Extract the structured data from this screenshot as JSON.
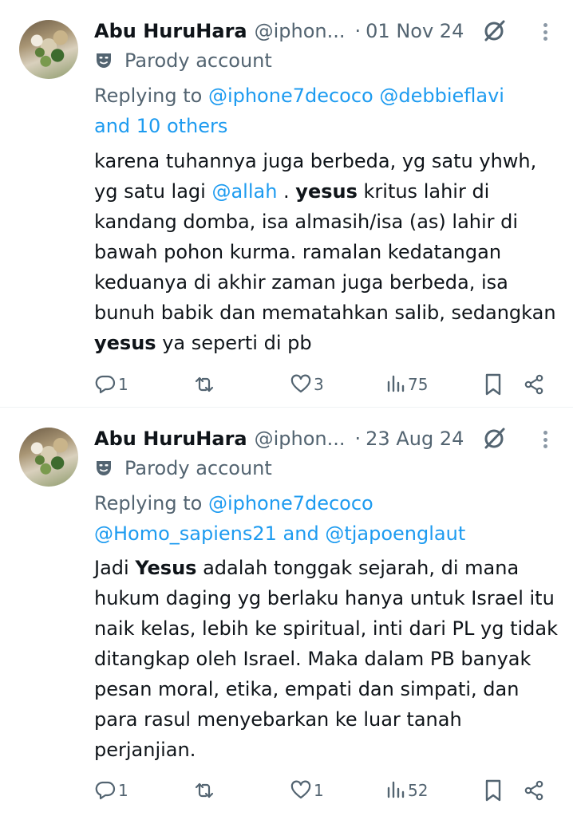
{
  "tweets": [
    {
      "name": "Abu HuruHara",
      "handle": "@iphon...",
      "date": "01 Nov 24",
      "badge": "Parody account",
      "replying_prefix": "Replying to ",
      "replying_mentions": "@iphone7decoco @debbieflavi",
      "replying_line2": "and 10 others",
      "body_parts": [
        {
          "t": "karena tuhannya juga berbeda, yg satu yhwh, yg satu lagi ",
          "style": "text"
        },
        {
          "t": "@allah",
          "style": "mention"
        },
        {
          "t": " . ",
          "style": "text"
        },
        {
          "t": "yesus",
          "style": "bold"
        },
        {
          "t": " kritus lahir di kandang domba, isa almasih/isa (as) lahir di bawah pohon kurma. ramalan kedatangan keduanya di akhir zaman juga berbeda, isa bunuh babik dan mematahkan salib, sedangkan ",
          "style": "text"
        },
        {
          "t": "yesus",
          "style": "bold"
        },
        {
          "t": " ya seperti di pb",
          "style": "text"
        }
      ],
      "replies": "1",
      "reposts": "",
      "likes": "3",
      "views": "75"
    },
    {
      "name": "Abu HuruHara",
      "handle": "@iphon...",
      "date": "23 Aug 24",
      "badge": "Parody account",
      "replying_prefix": "Replying to ",
      "replying_mentions": "@iphone7decoco",
      "replying_line2": "@Homo_sapiens21 and @tjapoenglaut",
      "body_parts": [
        {
          "t": "Jadi ",
          "style": "text"
        },
        {
          "t": "Yesus",
          "style": "bold"
        },
        {
          "t": " adalah tonggak sejarah, di mana hukum daging yg berlaku hanya untuk Israel itu naik kelas, lebih ke spiritual, inti dari PL yg tidak ditangkap oleh Israel. Maka dalam PB banyak pesan moral, etika, empati dan simpati, dan para rasul menyebarkan ke luar tanah perjanjian.",
          "style": "text"
        }
      ],
      "replies": "1",
      "reposts": "",
      "likes": "1",
      "views": "52"
    }
  ],
  "icons": {
    "grok": "grok-slash-icon",
    "more": "more-vertical-icon",
    "parody": "theater-mask-icon",
    "reply": "reply-icon",
    "repost": "repost-icon",
    "like": "heart-icon",
    "views": "views-chart-icon",
    "bookmark": "bookmark-icon",
    "share": "share-icon"
  },
  "colors": {
    "text": "#0f1419",
    "secondary": "#536471",
    "accent": "#1d9bf0",
    "divider": "#eff3f4"
  }
}
